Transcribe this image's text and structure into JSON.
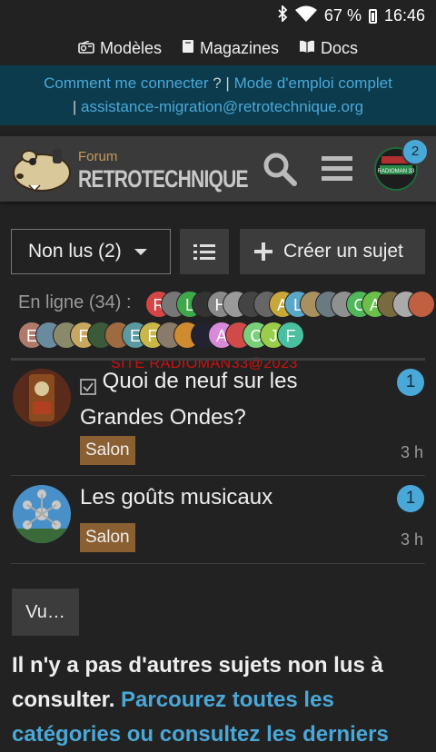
{
  "status": {
    "battery": "67 %",
    "time": "16:46"
  },
  "topnav": {
    "models": "Modèles",
    "magazines": "Magazines",
    "docs": "Docs"
  },
  "notice": {
    "link1": "Comment me connecter",
    "mid": " ? | ",
    "link2": "Mode d'emploi complet",
    "sep2": "| ",
    "email": "assistance-migration@retrotechnique.org"
  },
  "header": {
    "logo_small": "Forum",
    "logo_big": "RETROTECHNIQUE",
    "avatar_text": "RADIOMAN 33",
    "notif_count": "2"
  },
  "controls": {
    "filter_label": "Non lus (2)",
    "create_label": "Créer un sujet"
  },
  "online": {
    "label": "En ligne (34) :"
  },
  "online_avatars": [
    {
      "letter": "R",
      "color": "#d64545"
    },
    {
      "letter": "",
      "color": "#777777"
    },
    {
      "letter": "L",
      "color": "#3fa84a"
    },
    {
      "letter": "",
      "color": "#333333"
    },
    {
      "letter": "H",
      "color": "#8a8a8a"
    },
    {
      "letter": "",
      "color": "#9a9a9a"
    },
    {
      "letter": "",
      "color": "#444444"
    },
    {
      "letter": "",
      "color": "#666666"
    },
    {
      "letter": "A",
      "color": "#c8a83a"
    },
    {
      "letter": "L",
      "color": "#5aa8c8"
    },
    {
      "letter": "",
      "color": "#a89060"
    },
    {
      "letter": "",
      "color": "#6a7a80"
    },
    {
      "letter": "",
      "color": "#909090"
    },
    {
      "letter": "C",
      "color": "#4fb85a"
    },
    {
      "letter": "A",
      "color": "#6ac04a"
    },
    {
      "letter": "",
      "color": "#7a6a40"
    },
    {
      "letter": "",
      "color": "#aaaaaa"
    },
    {
      "letter": "",
      "color": "#c06040"
    },
    {
      "letter": "E",
      "color": "#b07a6a"
    },
    {
      "letter": "",
      "color": "#6a8aa0"
    },
    {
      "letter": "",
      "color": "#8a8a6a"
    },
    {
      "letter": "F",
      "color": "#c8a860"
    },
    {
      "letter": "",
      "color": "#3a5a3a"
    },
    {
      "letter": "",
      "color": "#a06a40"
    },
    {
      "letter": "E",
      "color": "#5a9aa0"
    },
    {
      "letter": "F",
      "color": "#c8b84a"
    },
    {
      "letter": "",
      "color": "#8a7a6a"
    },
    {
      "letter": "",
      "color": "#d08a30"
    },
    {
      "letter": "",
      "color": "#222233"
    },
    {
      "letter": "A",
      "color": "#d88ad8"
    },
    {
      "letter": "",
      "color": "#d04a4a"
    },
    {
      "letter": "C",
      "color": "#7ad07a"
    },
    {
      "letter": "J",
      "color": "#9acd4a"
    },
    {
      "letter": "F",
      "color": "#4ac0a0"
    }
  ],
  "watermark": "SITE RADIOMAN33@2023",
  "topics": [
    {
      "title": "Quoi de neuf sur les Grandes Ondes?",
      "category": "Salon",
      "count": "1",
      "age": "3 h"
    },
    {
      "title": "Les goûts musicaux",
      "category": "Salon",
      "count": "1",
      "age": "3 h"
    }
  ],
  "more_label": "Vu…",
  "footer": {
    "text": "Il n'y a pas d'autres sujets non lus à consulter. ",
    "link": "Parcourez toutes les catégories ou consultez les derniers"
  },
  "colors": {
    "accent": "#4aa8d8",
    "category": "#8a6033",
    "notice_bg": "#0c3b4d"
  }
}
